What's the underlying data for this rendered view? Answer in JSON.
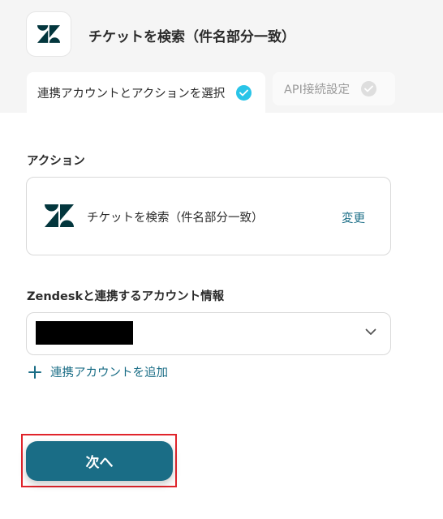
{
  "header": {
    "title": "チケットを検索（件名部分一致）",
    "logo_icon": "zendesk-logo"
  },
  "tabs": [
    {
      "label": "連携アカウントとアクションを選択",
      "status": "completed"
    },
    {
      "label": "API接続設定",
      "status": "pending"
    }
  ],
  "action_section": {
    "label": "アクション",
    "action_name": "チケットを検索（件名部分一致）",
    "change_label": "変更",
    "icon": "zendesk-logo"
  },
  "account_section": {
    "label": "Zendeskと連携するアカウント情報",
    "selected_value": "",
    "icon": "chevron-down-icon"
  },
  "add_account": {
    "label": "連携アカウントを追加",
    "icon": "plus-icon"
  },
  "footer": {
    "next_label": "次へ"
  },
  "colors": {
    "accent": "#1a6d86",
    "check_active": "#29c4e8",
    "highlight": "#e0242b",
    "zendesk": "#03363d"
  }
}
